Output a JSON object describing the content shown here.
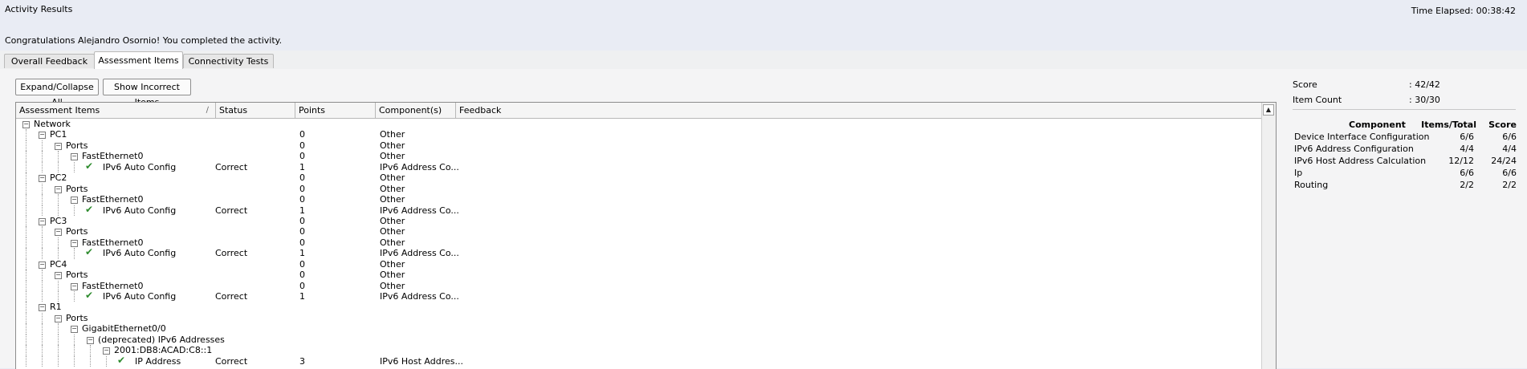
{
  "window": {
    "title": "Activity Results",
    "time_elapsed": "Time Elapsed: 00:38:42"
  },
  "message": "Congratulations Alejandro Osornio! You completed the activity.",
  "tabs": [
    {
      "label": "Overall Feedback",
      "active": false
    },
    {
      "label": "Assessment Items",
      "active": true
    },
    {
      "label": "Connectivity Tests",
      "active": false
    }
  ],
  "toolbar": {
    "expand_collapse_label": "Expand/Collapse All",
    "show_incorrect_label": "Show Incorrect Items"
  },
  "table": {
    "columns": [
      "Assessment Items",
      "Status",
      "Points",
      "Component(s)",
      "Feedback"
    ],
    "rows": [
      {
        "name": "Network",
        "depth": 0,
        "toggle": true,
        "check": false,
        "status": "",
        "points": "",
        "component": ""
      },
      {
        "name": "PC1",
        "depth": 1,
        "toggle": true,
        "check": false,
        "status": "",
        "points": "0",
        "component": "Other"
      },
      {
        "name": "Ports",
        "depth": 2,
        "toggle": true,
        "check": false,
        "status": "",
        "points": "0",
        "component": "Other"
      },
      {
        "name": "FastEthernet0",
        "depth": 3,
        "toggle": true,
        "check": false,
        "status": "",
        "points": "0",
        "component": "Other"
      },
      {
        "name": "IPv6 Auto Config",
        "depth": 4,
        "toggle": false,
        "check": true,
        "status": "Correct",
        "points": "1",
        "component": "IPv6 Address Co..."
      },
      {
        "name": "PC2",
        "depth": 1,
        "toggle": true,
        "check": false,
        "status": "",
        "points": "0",
        "component": "Other"
      },
      {
        "name": "Ports",
        "depth": 2,
        "toggle": true,
        "check": false,
        "status": "",
        "points": "0",
        "component": "Other"
      },
      {
        "name": "FastEthernet0",
        "depth": 3,
        "toggle": true,
        "check": false,
        "status": "",
        "points": "0",
        "component": "Other"
      },
      {
        "name": "IPv6 Auto Config",
        "depth": 4,
        "toggle": false,
        "check": true,
        "status": "Correct",
        "points": "1",
        "component": "IPv6 Address Co..."
      },
      {
        "name": "PC3",
        "depth": 1,
        "toggle": true,
        "check": false,
        "status": "",
        "points": "0",
        "component": "Other"
      },
      {
        "name": "Ports",
        "depth": 2,
        "toggle": true,
        "check": false,
        "status": "",
        "points": "0",
        "component": "Other"
      },
      {
        "name": "FastEthernet0",
        "depth": 3,
        "toggle": true,
        "check": false,
        "status": "",
        "points": "0",
        "component": "Other"
      },
      {
        "name": "IPv6 Auto Config",
        "depth": 4,
        "toggle": false,
        "check": true,
        "status": "Correct",
        "points": "1",
        "component": "IPv6 Address Co..."
      },
      {
        "name": "PC4",
        "depth": 1,
        "toggle": true,
        "check": false,
        "status": "",
        "points": "0",
        "component": "Other"
      },
      {
        "name": "Ports",
        "depth": 2,
        "toggle": true,
        "check": false,
        "status": "",
        "points": "0",
        "component": "Other"
      },
      {
        "name": "FastEthernet0",
        "depth": 3,
        "toggle": true,
        "check": false,
        "status": "",
        "points": "0",
        "component": "Other"
      },
      {
        "name": "IPv6 Auto Config",
        "depth": 4,
        "toggle": false,
        "check": true,
        "status": "Correct",
        "points": "1",
        "component": "IPv6 Address Co..."
      },
      {
        "name": "R1",
        "depth": 1,
        "toggle": true,
        "check": false,
        "status": "",
        "points": "",
        "component": ""
      },
      {
        "name": "Ports",
        "depth": 2,
        "toggle": true,
        "check": false,
        "status": "",
        "points": "",
        "component": ""
      },
      {
        "name": "GigabitEthernet0/0",
        "depth": 3,
        "toggle": true,
        "check": false,
        "status": "",
        "points": "",
        "component": ""
      },
      {
        "name": "(deprecated) IPv6 Addresses",
        "depth": 4,
        "toggle": true,
        "check": false,
        "status": "",
        "points": "",
        "component": ""
      },
      {
        "name": "2001:DB8:ACAD:C8::1",
        "depth": 5,
        "toggle": true,
        "check": false,
        "status": "",
        "points": "",
        "component": ""
      },
      {
        "name": "IP Address",
        "depth": 6,
        "toggle": false,
        "check": true,
        "status": "Correct",
        "points": "3",
        "component": "IPv6 Host Addres..."
      }
    ]
  },
  "summary": {
    "score_label": "Score",
    "score_value": ": 42/42",
    "item_count_label": "Item Count",
    "item_count_value": ": 30/30",
    "headers": [
      "Component",
      "Items/Total",
      "Score"
    ],
    "components": [
      {
        "name": "Device Interface Configuration",
        "items": "6/6",
        "score": "6/6"
      },
      {
        "name": "IPv6 Address Configuration",
        "items": "4/4",
        "score": "4/4"
      },
      {
        "name": "IPv6 Host Address Calculation",
        "items": "12/12",
        "score": "24/24"
      },
      {
        "name": "Ip",
        "items": "6/6",
        "score": "6/6"
      },
      {
        "name": "Routing",
        "items": "2/2",
        "score": "2/2"
      }
    ]
  }
}
